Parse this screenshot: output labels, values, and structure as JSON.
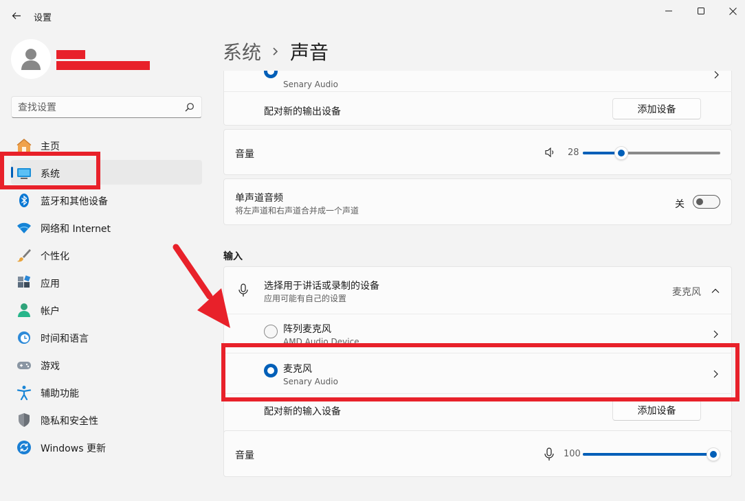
{
  "window": {
    "title": "设置"
  },
  "search": {
    "placeholder": "查找设置"
  },
  "nav": {
    "items": [
      {
        "label": "主页"
      },
      {
        "label": "系统"
      },
      {
        "label": "蓝牙和其他设备"
      },
      {
        "label": "网络和 Internet"
      },
      {
        "label": "个性化"
      },
      {
        "label": "应用"
      },
      {
        "label": "帐户"
      },
      {
        "label": "时间和语言"
      },
      {
        "label": "游戏"
      },
      {
        "label": "辅助功能"
      },
      {
        "label": "隐私和安全性"
      },
      {
        "label": "Windows 更新"
      }
    ],
    "selected": "系统"
  },
  "breadcrumb": {
    "parent": "系统",
    "current": "声音"
  },
  "output": {
    "device_sub": "Senary Audio",
    "pair_label": "配对新的输出设备",
    "add_button": "添加设备",
    "volume_label": "音量",
    "volume_value": "28",
    "volume_fraction": 0.28,
    "mono_title": "单声道音频",
    "mono_desc": "将左声道和右声道合并成一个声道",
    "mono_state": "关"
  },
  "input": {
    "section_title": "输入",
    "choose_title": "选择用于讲话或录制的设备",
    "choose_desc": "应用可能有自己的设置",
    "choose_value": "麦克风",
    "devices": [
      {
        "name": "阵列麦克风",
        "sub": "AMD Audio Device"
      },
      {
        "name": "麦克风",
        "sub": "Senary Audio"
      }
    ],
    "pair_label": "配对新的输入设备",
    "add_button": "添加设备",
    "volume_label": "音量",
    "volume_value": "100",
    "volume_fraction": 1.0
  },
  "colors": {
    "accent": "#005fb8",
    "annotation": "#e8212a"
  }
}
